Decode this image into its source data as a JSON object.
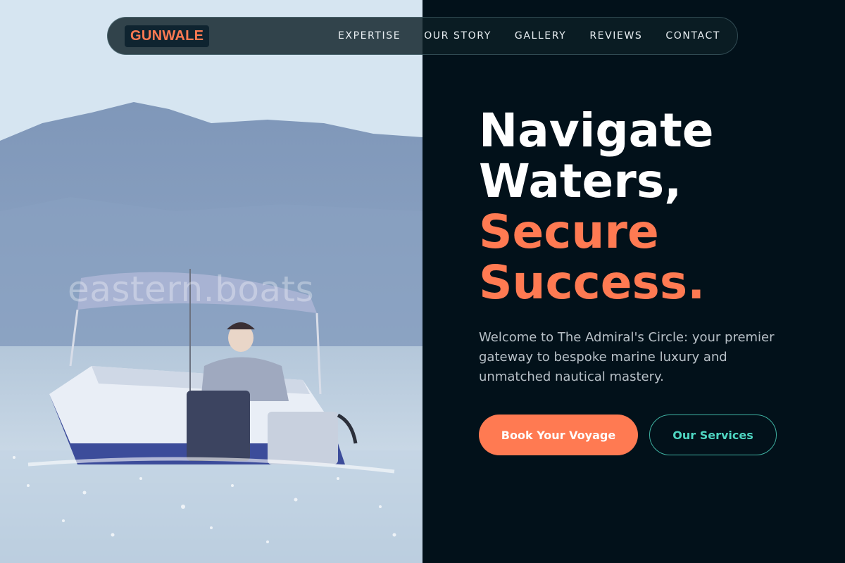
{
  "brand": {
    "logo_text": "GUNWALE"
  },
  "nav": {
    "links": [
      "EXPERTISE",
      "OUR STORY",
      "GALLERY",
      "REVIEWS",
      "CONTACT"
    ]
  },
  "hero": {
    "title_line1": "Navigate",
    "title_line2": "Waters,",
    "title_accent1": "Secure",
    "title_accent2": "Success.",
    "description": "Welcome to The Admiral's Circle: your premier gateway to bespoke marine luxury and unmatched nautical mastery.",
    "primary_button": "Book Your Voyage",
    "secondary_button": "Our Services"
  },
  "photo": {
    "watermark": "eastern.boats"
  },
  "colors": {
    "accent": "#ff7a52",
    "teal": "#4fd6c2",
    "panel_bg": "#02111a"
  }
}
